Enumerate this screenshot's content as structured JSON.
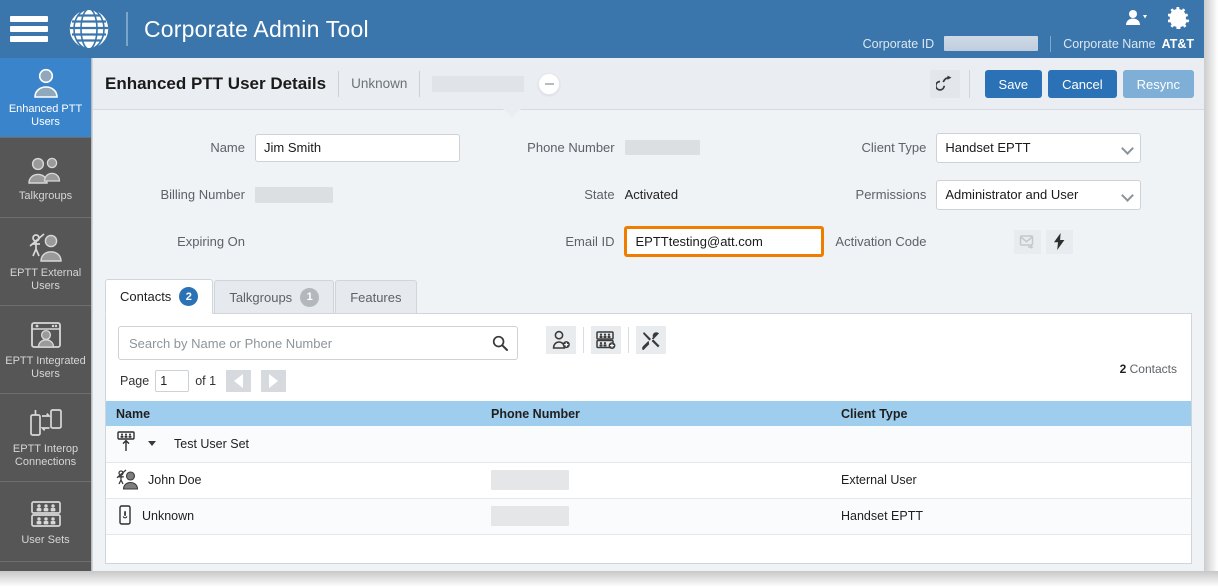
{
  "header": {
    "app_title": "Corporate Admin Tool",
    "logo_name": "AT&T",
    "menu_icon": "hamburger-menu-icon",
    "user_icon": "user-dropdown-icon",
    "settings_icon": "gear-icon",
    "corporate_id_label": "Corporate ID",
    "corporate_id_value": "",
    "corporate_name_label": "Corporate Name",
    "corporate_name_value": "AT&T"
  },
  "sidebar": {
    "items": [
      {
        "label": "Enhanced PTT Users",
        "line1": "Enhanced PTT",
        "line2": "Users",
        "icon": "single-user-icon",
        "active": true
      },
      {
        "label": "Talkgroups",
        "line1": "Talkgroups",
        "line2": "",
        "icon": "group-users-icon",
        "active": false
      },
      {
        "label": "EPTT External Users",
        "line1": "EPTT External",
        "line2": "Users",
        "icon": "external-user-icon",
        "active": false
      },
      {
        "label": "EPTT Integrated Users",
        "line1": "EPTT Integrated",
        "line2": "Users",
        "icon": "integrated-user-window-icon",
        "active": false
      },
      {
        "label": "EPTT Interop Connections",
        "line1": "EPTT Interop",
        "line2": "Connections",
        "icon": "interop-devices-icon",
        "active": false
      },
      {
        "label": "User Sets",
        "line1": "User Sets",
        "line2": "",
        "icon": "user-sets-icon",
        "active": false
      }
    ]
  },
  "page": {
    "title": "Enhanced PTT User Details",
    "subtitle": "Unknown",
    "redacted_value": "",
    "collapse_icon": "minus-circle-icon",
    "export_icon": "share-export-icon",
    "buttons": {
      "save": "Save",
      "cancel": "Cancel",
      "resync": "Resync"
    }
  },
  "form": {
    "name_label": "Name",
    "name_value": "Jim Smith",
    "billing_number_label": "Billing Number",
    "billing_number_value": "",
    "expiring_on_label": "Expiring On",
    "expiring_on_value": "",
    "phone_number_label": "Phone Number",
    "phone_number_value": "",
    "state_label": "State",
    "state_value": "Activated",
    "email_id_label": "Email ID",
    "email_id_value": "EPTTtesting@att.com",
    "client_type_label": "Client Type",
    "client_type_value": "Handset EPTT",
    "permissions_label": "Permissions",
    "permissions_value": "Administrator and User",
    "activation_code_label": "Activation Code",
    "activation_email_icon": "email-send-icon",
    "activation_bolt_icon": "lightning-bolt-icon",
    "highlight_color": "#ef7d00"
  },
  "tabs": [
    {
      "label": "Contacts",
      "count": "2",
      "active": true
    },
    {
      "label": "Talkgroups",
      "count": "1",
      "active": false
    },
    {
      "label": "Features",
      "count": "",
      "active": false
    }
  ],
  "panel": {
    "search_placeholder": "Search by Name or Phone Number",
    "search_value": "",
    "search_icon": "search-icon",
    "tools": [
      {
        "name": "add-contact-icon"
      },
      {
        "name": "add-user-set-icon"
      },
      {
        "name": "tools-settings-icon"
      }
    ],
    "pager": {
      "page_label": "Page",
      "page_value": "1",
      "of_label": "of 1",
      "prev_icon": "prev-page-icon",
      "next_icon": "next-page-icon"
    },
    "count_number": "2",
    "count_label": "Contacts"
  },
  "table": {
    "columns": [
      "Name",
      "Phone Number",
      "Client Type"
    ],
    "rows": [
      {
        "icon": "user-set-group-icon",
        "has_caret": true,
        "name": "Test User Set",
        "phone": "",
        "client_type": ""
      },
      {
        "icon": "external-user-icon",
        "has_caret": false,
        "name": "John Doe",
        "phone": "",
        "client_type": "External User"
      },
      {
        "icon": "handset-device-icon",
        "has_caret": false,
        "name": "Unknown",
        "phone": "",
        "client_type": "Handset EPTT"
      }
    ]
  },
  "colors": {
    "brand_blue": "#3a76ab",
    "accent_blue": "#2a72b5",
    "sidebar_gray": "#565656",
    "table_header_blue": "#9fcdee",
    "highlight_orange": "#ef7d00"
  }
}
